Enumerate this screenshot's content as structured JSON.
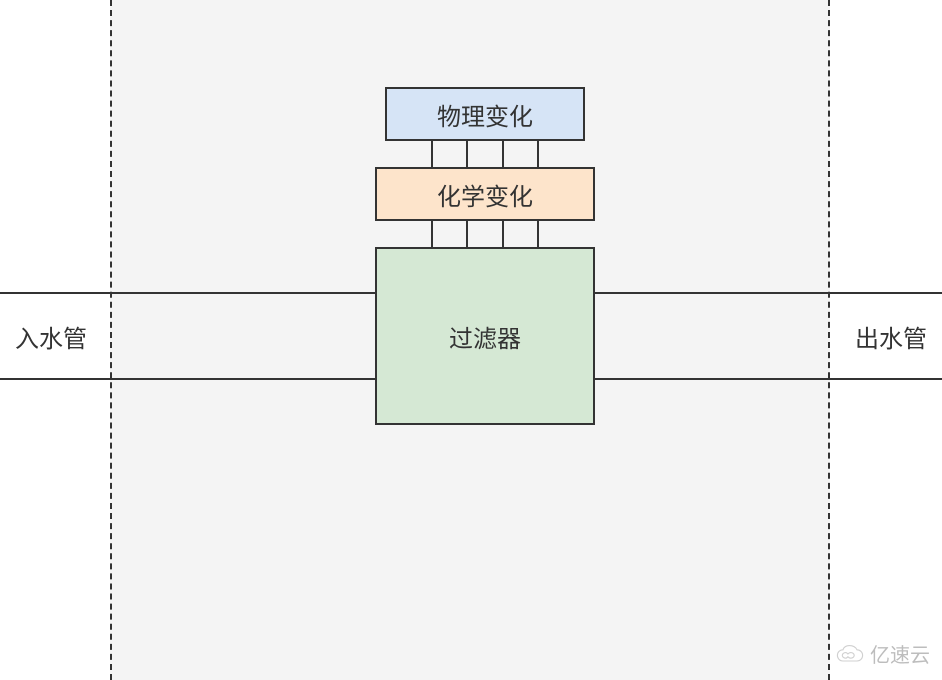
{
  "diagram": {
    "input_pipe": "入水管",
    "output_pipe": "出水管",
    "box_physical": "物理变化",
    "box_chemical": "化学变化",
    "box_filter": "过滤器"
  },
  "watermark": {
    "text": "亿速云"
  }
}
